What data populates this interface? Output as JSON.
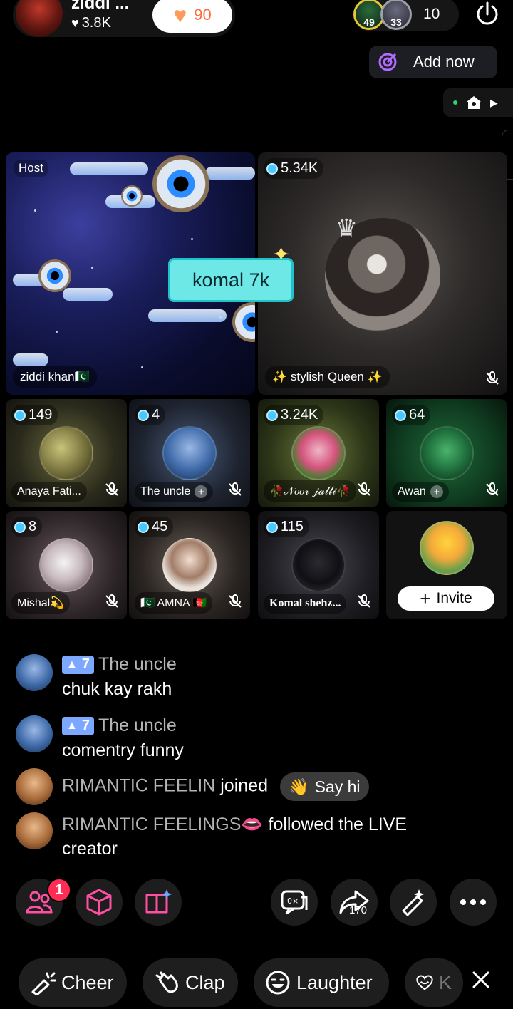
{
  "host": {
    "name": "ziddi ...",
    "likes": "3.8K",
    "follow_count": "90"
  },
  "viewers": {
    "badge1": "49",
    "badge2": "33",
    "count": "10"
  },
  "addnow_label": "Add now",
  "gift_banner": "komal 7k",
  "tiles": {
    "host": {
      "tag": "Host",
      "name": "ziddi khan🇵🇰"
    },
    "queen": {
      "count": "5.34K",
      "name": "✨ stylish Queen ✨"
    },
    "guests": [
      {
        "count": "149",
        "name": "Anaya Fati..."
      },
      {
        "count": "4",
        "name": "The uncle"
      },
      {
        "count": "3.24K",
        "name": "🥀𝒩𝑜𝑜𝓇 𝒿𝒶𝓁𝓁𝒾🥀"
      },
      {
        "count": "64",
        "name": "Awan"
      },
      {
        "count": "8",
        "name": "Mishal💫"
      },
      {
        "count": "45",
        "name": "🇵🇰 AMNA 🇦🇫"
      },
      {
        "count": "115",
        "name": "Komal shehz..."
      }
    ],
    "invite_label": "Invite"
  },
  "chat": {
    "messages": [
      {
        "level": "7",
        "user": "The uncle",
        "text": "chuk kay rakh"
      },
      {
        "level": "7",
        "user": "The uncle",
        "text": "comentry funny"
      }
    ],
    "join_event": {
      "user": "RIMANTIC FEELIN",
      "action": "joined",
      "button": "Say hi"
    },
    "follow_event": {
      "user": "RIMANTIC FEELINGS👄",
      "action": "followed the LIVE",
      "action2": "creator"
    }
  },
  "toolbar": {
    "friends_badge": "1",
    "share_count": "170"
  },
  "reactions": {
    "cheer": "Cheer",
    "clap": "Clap",
    "laughter": "Laughter",
    "more": "K"
  }
}
